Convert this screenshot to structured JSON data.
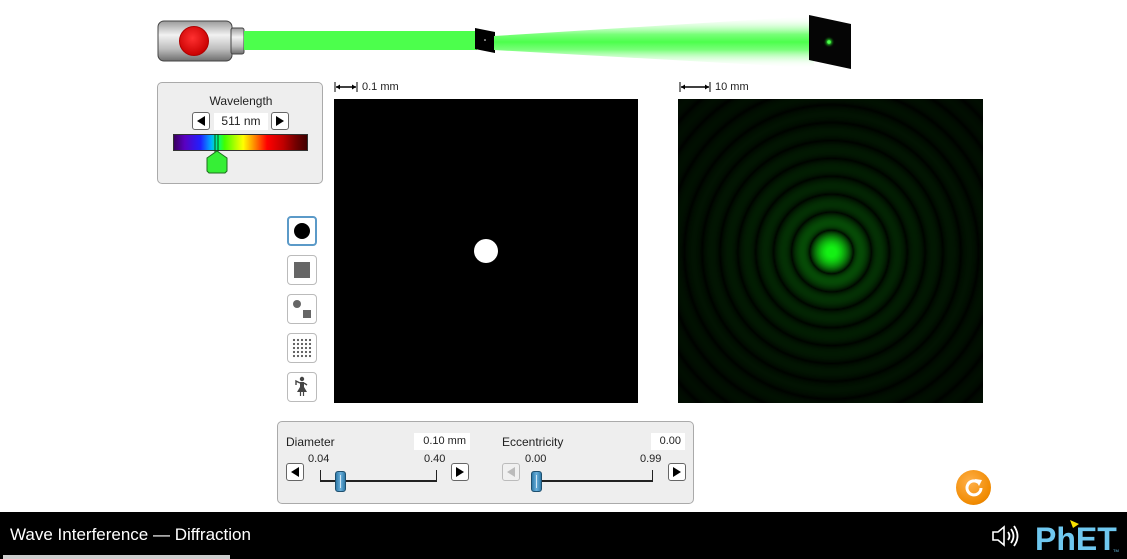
{
  "app": {
    "title": "Wave Interference — Diffraction"
  },
  "wavelength": {
    "title": "Wavelength",
    "value": "511 nm",
    "value_nm": 511,
    "range_nm": [
      380,
      780
    ],
    "beam_color": "#4cff4c",
    "decrement_icon": "triangle-left-icon",
    "increment_icon": "triangle-right-icon"
  },
  "scales": {
    "aperture": "0.1 mm",
    "diffraction": "10 mm"
  },
  "shapes": [
    {
      "name": "circle",
      "icon": "filled-circle-icon",
      "selected": true
    },
    {
      "name": "rectangle",
      "icon": "filled-square-icon",
      "selected": false
    },
    {
      "name": "circle-and-square",
      "icon": "circle-square-icon",
      "selected": false
    },
    {
      "name": "lattice",
      "icon": "dot-grid-icon",
      "selected": false
    },
    {
      "name": "disorder",
      "icon": "person-icon",
      "selected": false
    }
  ],
  "controls": {
    "diameter": {
      "label": "Diameter",
      "value": "0.10 mm",
      "min_label": "0.04",
      "max_label": "0.40",
      "min": 0.04,
      "max": 0.4,
      "current": 0.1
    },
    "eccentricity": {
      "label": "Eccentricity",
      "value": "0.00",
      "min_label": "0.00",
      "max_label": "0.99",
      "min": 0.0,
      "max": 0.99,
      "current": 0.0,
      "decrement_disabled": true
    }
  },
  "colors": {
    "beam": "#4cff4c",
    "accent": "#5b9ac8",
    "reset": "#f08a00",
    "phet_blue": "#6fc8f0",
    "phet_yellow": "#f7e000"
  },
  "nav": {
    "sound_icon": "speaker-icon",
    "logo_text": "PhET",
    "reset_icon": "reset-icon"
  }
}
